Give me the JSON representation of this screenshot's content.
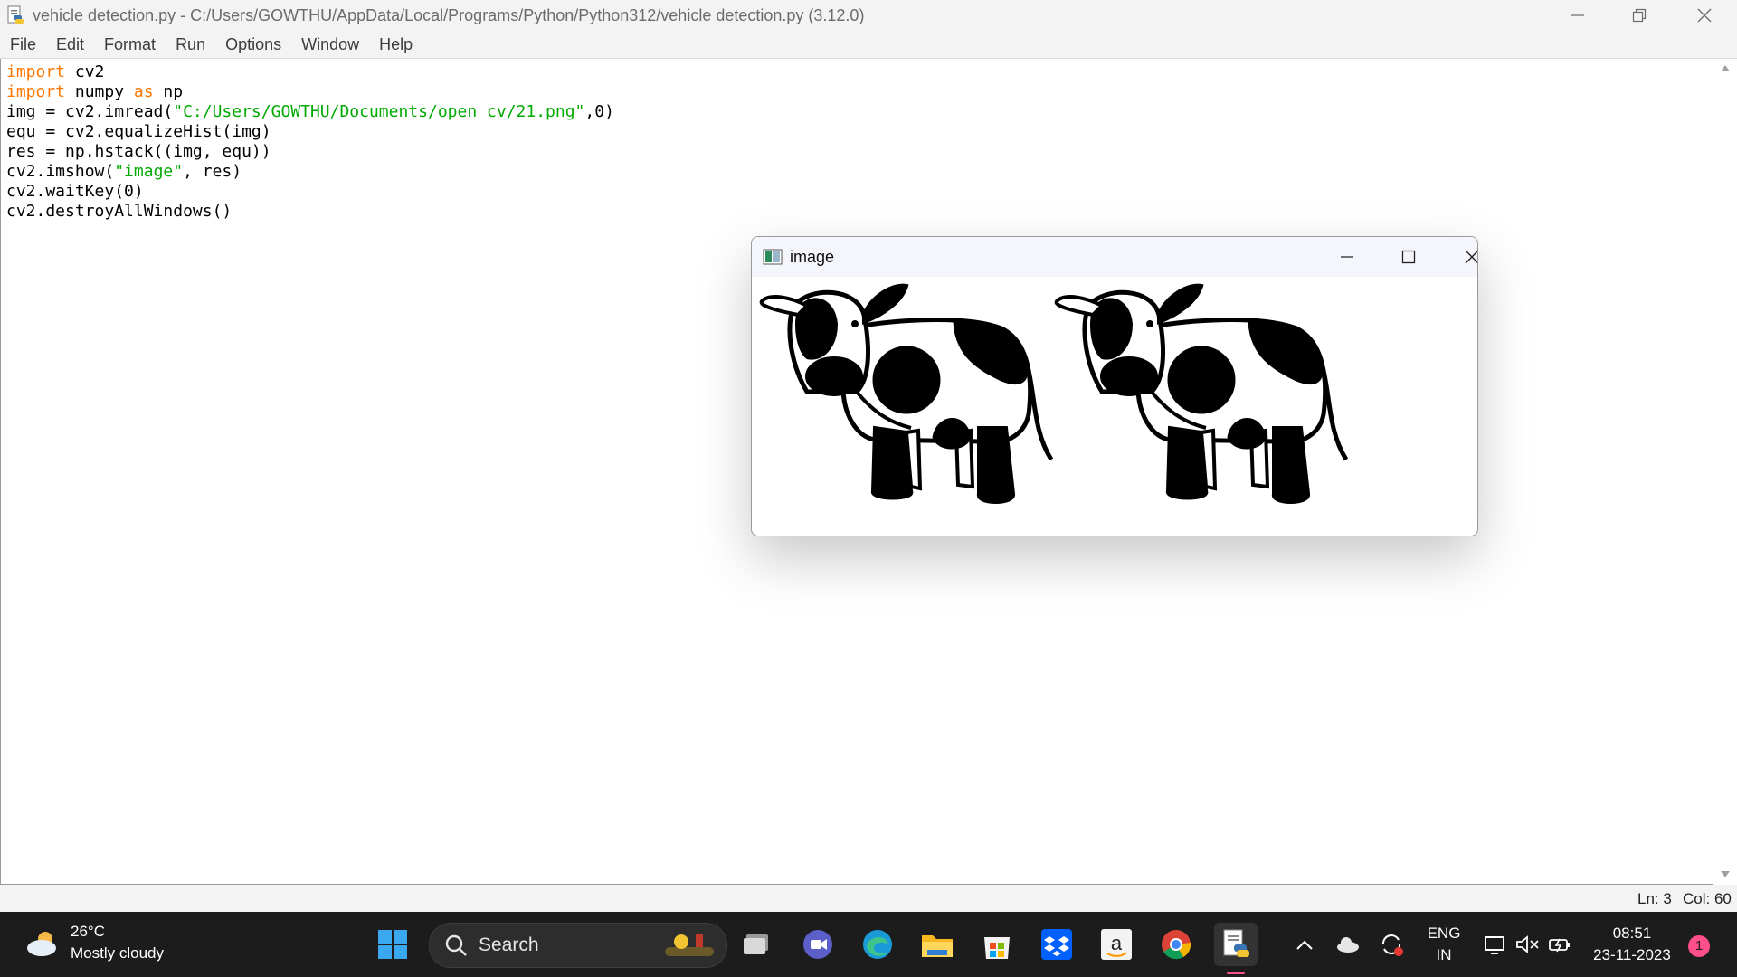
{
  "window": {
    "title": "vehicle detection.py - C:/Users/GOWTHU/AppData/Local/Programs/Python/Python312/vehicle detection.py (3.12.0)"
  },
  "menu": [
    "File",
    "Edit",
    "Format",
    "Run",
    "Options",
    "Window",
    "Help"
  ],
  "code": {
    "lines": [
      [
        {
          "t": "import",
          "c": "kw"
        },
        {
          "t": " cv2",
          "c": ""
        }
      ],
      [
        {
          "t": "import",
          "c": "kw"
        },
        {
          "t": " numpy ",
          "c": ""
        },
        {
          "t": "as",
          "c": "kw"
        },
        {
          "t": " np",
          "c": ""
        }
      ],
      [
        {
          "t": "img = cv2.imread(",
          "c": ""
        },
        {
          "t": "\"C:/Users/GOWTHU/Documents/open cv/21.png\"",
          "c": "str"
        },
        {
          "t": ",0)",
          "c": ""
        }
      ],
      [
        {
          "t": "equ = cv2.equalizeHist(img)",
          "c": ""
        }
      ],
      [
        {
          "t": "res = np.hstack((img, equ))",
          "c": ""
        }
      ],
      [
        {
          "t": "cv2.imshow(",
          "c": ""
        },
        {
          "t": "\"image\"",
          "c": "str"
        },
        {
          "t": ", res)",
          "c": ""
        }
      ],
      [
        {
          "t": "cv2.waitKey(0)",
          "c": ""
        }
      ],
      [
        {
          "t": "cv2.destroyAllWindows()",
          "c": ""
        }
      ]
    ]
  },
  "status": {
    "ln": "Ln: 3",
    "col": "Col: 60"
  },
  "image_window": {
    "title": "image"
  },
  "taskbar": {
    "weather_temp": "26°C",
    "weather_desc": "Mostly cloudy",
    "search_label": "Search",
    "lang_top": "ENG",
    "lang_bottom": "IN",
    "time": "08:51",
    "date": "23-11-2023",
    "notification_count": "1"
  },
  "colors": {
    "keyword": "#ff7700",
    "string": "#00aa00",
    "taskbar_bg": "#1c1c1c",
    "notification_badge": "#ff4f8b"
  },
  "icons": [
    "python-file-icon",
    "minimize-icon",
    "restore-icon",
    "close-icon",
    "weather-cloud-icon",
    "windows-start-icon",
    "search-icon",
    "task-view-icon",
    "teams-icon",
    "edge-icon",
    "file-explorer-icon",
    "ms-store-icon",
    "dropbox-icon",
    "amazon-icon",
    "chrome-icon",
    "idle-icon",
    "chevron-up-icon",
    "onedrive-icon",
    "sync-icon",
    "network-icon",
    "mute-icon",
    "battery-icon"
  ]
}
